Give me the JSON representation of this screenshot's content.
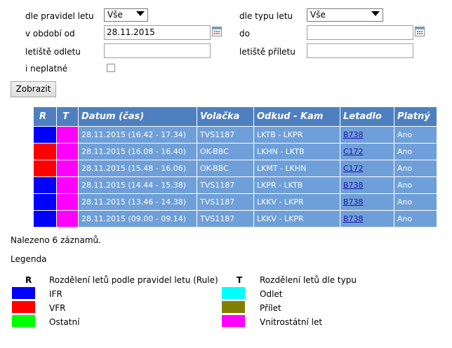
{
  "filters": {
    "rule_label": "dle pravidel letu",
    "rule_value": "Vše",
    "type_label": "dle typu letu",
    "type_value": "Vše",
    "from_label": "v období od",
    "from_value": "28.11.2015",
    "to_label": "do",
    "to_value": "",
    "dep_label": "letiště odletu",
    "dep_value": "",
    "arr_label": "letiště příletu",
    "arr_value": "",
    "invalid_label": "i neplatné",
    "show_button": "Zobrazit"
  },
  "table": {
    "headers": [
      "R",
      "T",
      "Datum (čas)",
      "Volačka",
      "Odkud - Kam",
      "Letadlo",
      "Platný"
    ],
    "rows": [
      {
        "r_color": "#0000ff",
        "t_color": "#ff00ff",
        "date": "28.11.2015 (16.42 - 17.34)",
        "callsign": "TVS1187",
        "route": "LKTB - LKPR",
        "aircraft": "B738",
        "valid": "Ano"
      },
      {
        "r_color": "#ff0000",
        "t_color": "#ff00ff",
        "date": "28.11.2015 (16.08 - 16.40)",
        "callsign": "OK-BBC",
        "route": "LKHN - LKTB",
        "aircraft": "C172",
        "valid": "Ano"
      },
      {
        "r_color": "#ff0000",
        "t_color": "#ff00ff",
        "date": "28.11.2015 (15.48 - 16.06)",
        "callsign": "OK-BBC",
        "route": "LKMT - LKHN",
        "aircraft": "C172",
        "valid": "Ano"
      },
      {
        "r_color": "#0000ff",
        "t_color": "#ff00ff",
        "date": "28.11.2015 (14.44 - 15.38)",
        "callsign": "TVS1187",
        "route": "LKPR - LKTB",
        "aircraft": "B738",
        "valid": "Ano"
      },
      {
        "r_color": "#0000ff",
        "t_color": "#ff00ff",
        "date": "28.11.2015 (13.46 - 14.38)",
        "callsign": "TVS1187",
        "route": "LKKV - LKPR",
        "aircraft": "B738",
        "valid": "Ano"
      },
      {
        "r_color": "#0000ff",
        "t_color": "#ff00ff",
        "date": "28.11.2015 (09.00 - 09.14)",
        "callsign": "TVS1187",
        "route": "LKKV - LKPR",
        "aircraft": "B738",
        "valid": "Ano"
      }
    ]
  },
  "result_count": "Nalezeno 6 záznamů.",
  "legend": {
    "title": "Legenda",
    "rule_key": "R",
    "rule_desc": "Rozdělení letů podle pravidel letu (Rule)",
    "rule_items": [
      {
        "color": "#0000ff",
        "label": "IFR"
      },
      {
        "color": "#ff0000",
        "label": "VFR"
      },
      {
        "color": "#00ff00",
        "label": "Ostatní"
      }
    ],
    "type_key": "T",
    "type_desc": "Rozdělení letů dle typu",
    "type_items": [
      {
        "color": "#00ffff",
        "label": "Odlet"
      },
      {
        "color": "#808000",
        "label": "Přílet"
      },
      {
        "color": "#ff00ff",
        "label": "Vnitrostátní let"
      }
    ]
  }
}
